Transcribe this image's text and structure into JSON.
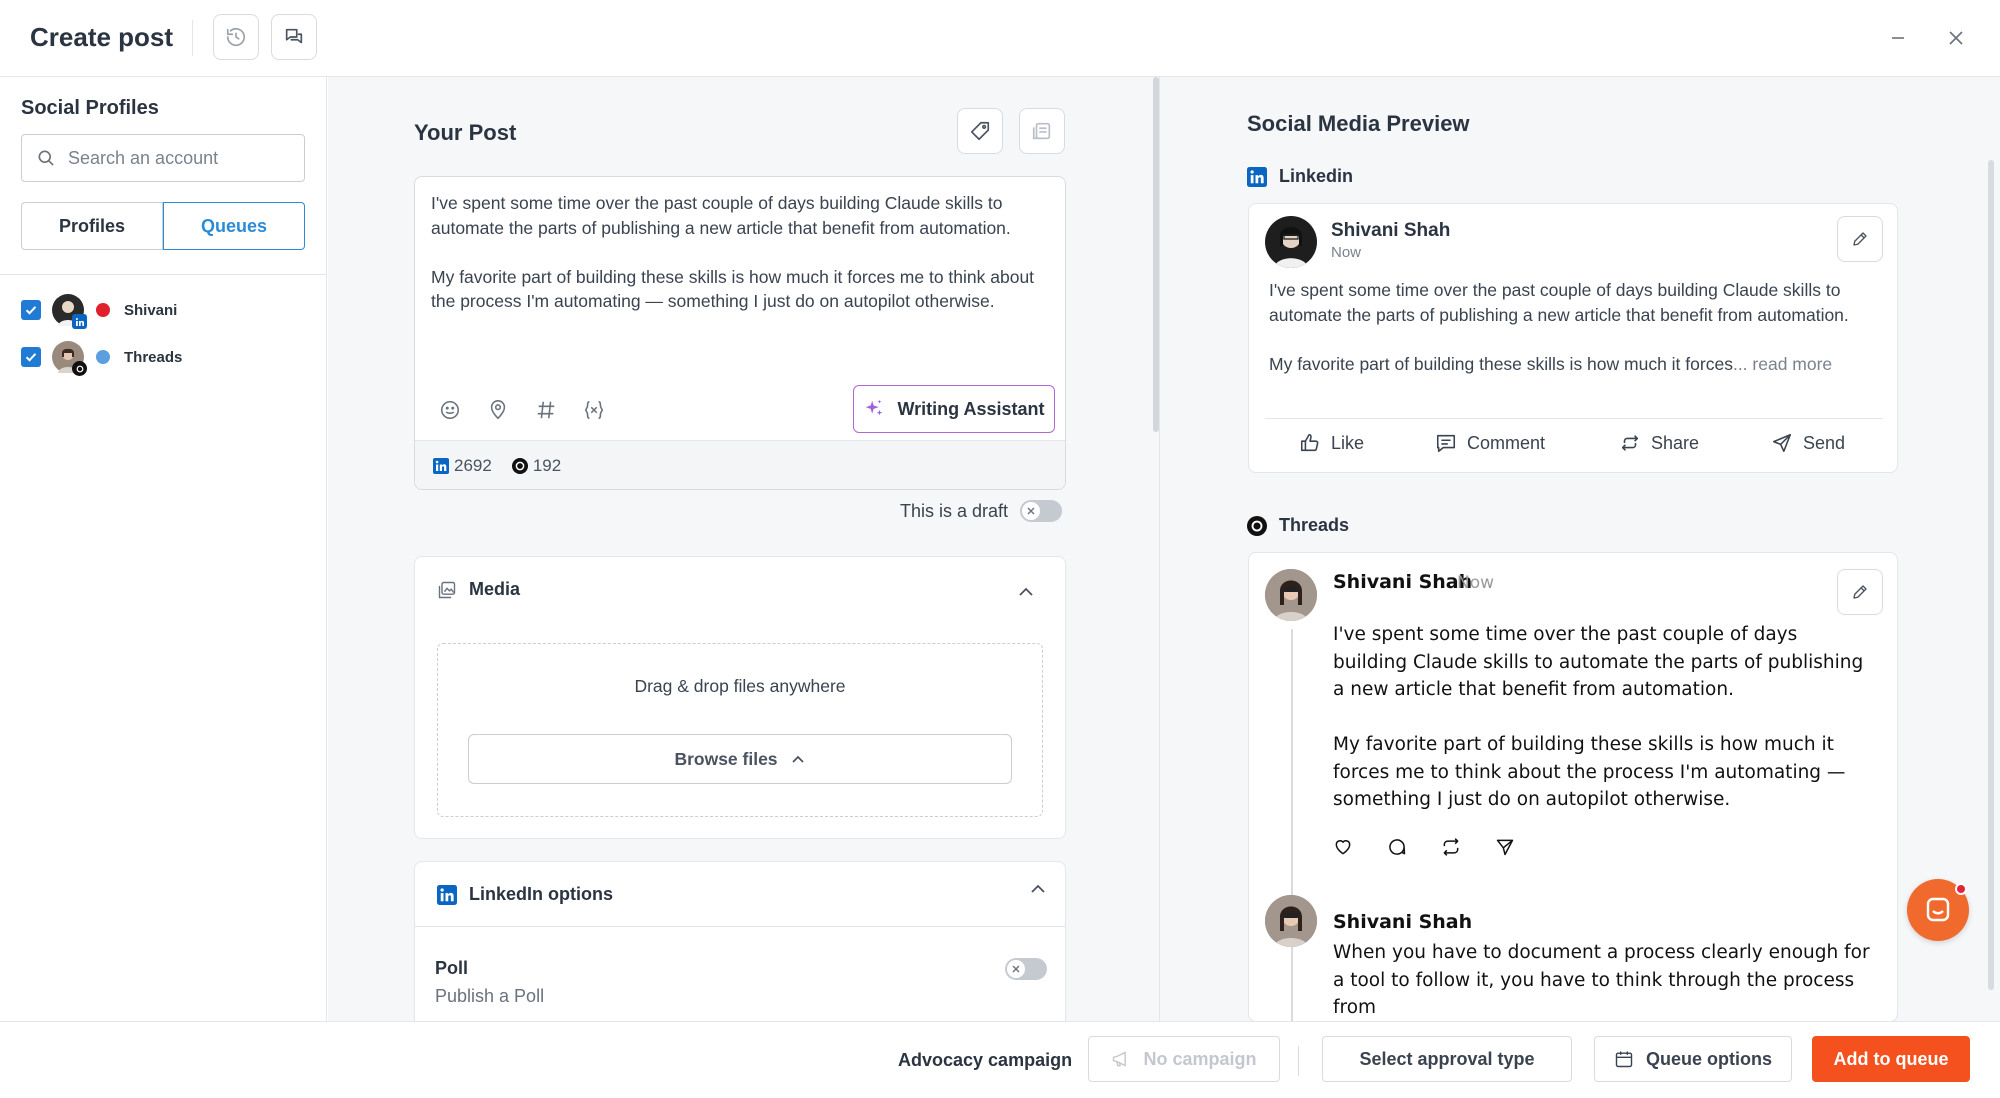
{
  "header": {
    "title": "Create post"
  },
  "sidebar": {
    "title": "Social Profiles",
    "search_placeholder": "Search an account",
    "tabs": [
      "Profiles",
      "Queues"
    ],
    "active_tab": "Queues",
    "profiles": [
      {
        "name": "Shivani",
        "network": "linkedin",
        "checked": true,
        "dot_color": "#e0202a"
      },
      {
        "name": "Threads",
        "network": "threads",
        "checked": true,
        "dot_color": "#5a9fe0"
      }
    ]
  },
  "post": {
    "title": "Your Post",
    "text": "I've spent some time over the past couple of days building Claude skills to automate the parts of publishing a new article that benefit from automation.\n\nMy favorite part of building these skills is how much it forces me to think about the process I'm automating — something I just do on autopilot otherwise.",
    "writing_assistant_label": "Writing Assistant",
    "counts": {
      "linkedin": "2692",
      "threads": "192"
    },
    "draft_label": "This is a draft",
    "draft_enabled": false
  },
  "media": {
    "title": "Media",
    "drop_text": "Drag & drop files anywhere",
    "browse_label": "Browse files"
  },
  "linkedin_options": {
    "title": "LinkedIn options",
    "poll_title": "Poll",
    "poll_subtitle": "Publish a Poll",
    "poll_enabled": false
  },
  "preview": {
    "title": "Social Media Preview",
    "linkedin": {
      "label": "Linkedin",
      "name": "Shivani Shah",
      "time": "Now",
      "text": "I've spent some time over the past couple of days building Claude skills to automate the parts of publishing a new article that benefit from automation.\n\nMy favorite part of building these skills is how much it forces",
      "read_more": "... read more",
      "actions": [
        "Like",
        "Comment",
        "Share",
        "Send"
      ]
    },
    "threads": {
      "label": "Threads",
      "name": "Shivani Shah",
      "time": "Now",
      "text": "I've spent some time over the past couple of days building Claude skills to automate the parts of publishing a new article that benefit from automation.\n\nMy favorite part of building these skills is how much it forces me to think about the process I'm automating — something I just do on autopilot otherwise.",
      "reply_name": "Shivani Shah",
      "reply_text": "When you have to document a process clearly enough for a tool to follow it, you have to think through the process from"
    }
  },
  "footer": {
    "advocacy_label": "Advocacy campaign",
    "campaign_label": "No campaign",
    "approval_label": "Select approval type",
    "queue_options_label": "Queue options",
    "add_label": "Add to queue"
  },
  "colors": {
    "accent": "#2b8bd8",
    "primary": "#f4511e",
    "linkedin": "#0a66c2",
    "writing_assistant_border": "#b068d8"
  }
}
